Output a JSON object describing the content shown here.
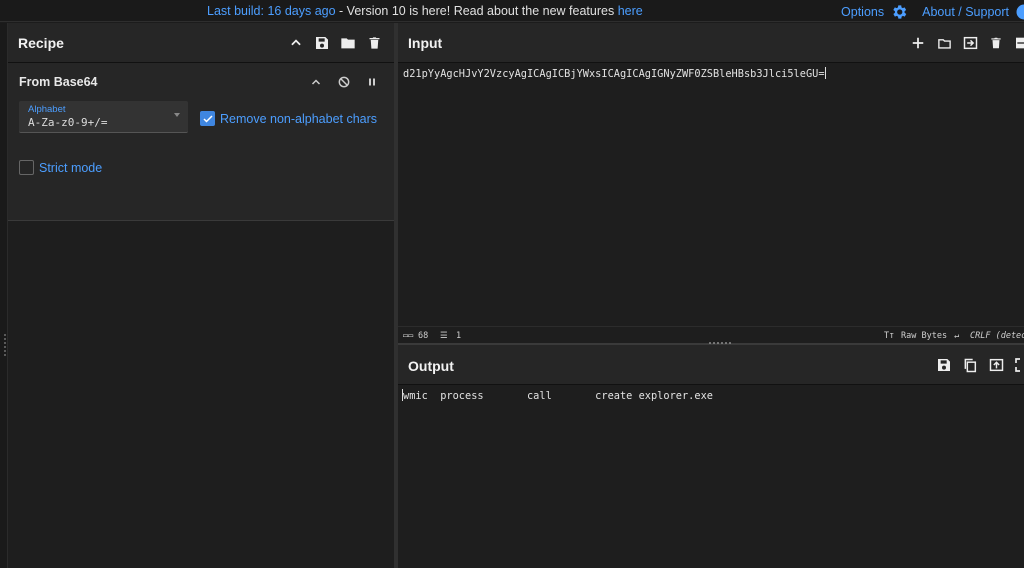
{
  "banner": {
    "build_link": "Last build: 16 days ago",
    "middle": " - Version 10 is here! Read about the new features ",
    "here_link": "here",
    "options": "Options",
    "about": "About / Support"
  },
  "recipe": {
    "title": "Recipe",
    "operation": {
      "title": "From Base64",
      "alphabet_label": "Alphabet",
      "alphabet_value": "A-Za-z0-9+/=",
      "remove_label": "Remove non-alphabet chars",
      "remove_checked": true,
      "strict_label": "Strict mode",
      "strict_checked": false
    }
  },
  "input": {
    "title": "Input",
    "text": "d21pYyAgcHJvY2VzcyAgICAgICBjYWxsICAgICAgIGNyZWF0ZSBleHBsb3Jlci5leGU=",
    "status_length": "68",
    "status_lines": "1",
    "raw_bytes": "Raw Bytes",
    "eol": "CRLF (detec"
  },
  "output": {
    "title": "Output",
    "text": "wmic  process       call       create explorer.exe"
  },
  "colors": {
    "accent": "#4c9eff",
    "panel": "#262626",
    "background": "#1e1e1e"
  }
}
